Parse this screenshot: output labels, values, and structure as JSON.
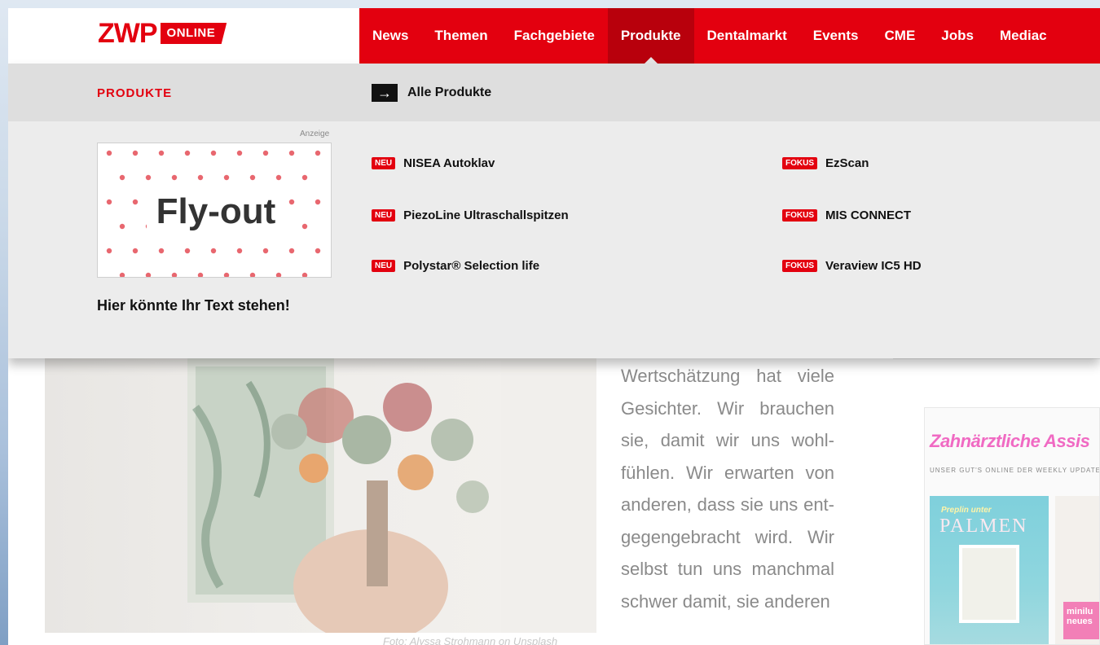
{
  "brand": {
    "logo_main": "ZWP",
    "logo_badge": "ONLINE",
    "accent": "#e3000f"
  },
  "nav": {
    "items": [
      {
        "label": "News"
      },
      {
        "label": "Themen"
      },
      {
        "label": "Fachgebiete"
      },
      {
        "label": "Produkte",
        "active": true
      },
      {
        "label": "Dentalmarkt"
      },
      {
        "label": "Events"
      },
      {
        "label": "CME"
      },
      {
        "label": "Jobs"
      },
      {
        "label": "Mediac"
      }
    ]
  },
  "flyout": {
    "title": "PRODUKTE",
    "all_link": "Alle Produkte",
    "ad": {
      "label": "Anzeige",
      "image_text": "Fly-out",
      "caption": "Hier könnte Ihr Text stehen!"
    },
    "products_left": [
      {
        "badge": "NEU",
        "label": "NISEA Autoklav"
      },
      {
        "badge": "NEU",
        "label": "PiezoLine Ultraschallspitzen"
      },
      {
        "badge": "NEU",
        "label": "Polystar® Selection life"
      }
    ],
    "products_right": [
      {
        "badge": "FOKUS",
        "label": "EzScan"
      },
      {
        "badge": "FOKUS",
        "label": "MIS CONNECT"
      },
      {
        "badge": "FOKUS",
        "label": "Veraview IC5 HD"
      }
    ]
  },
  "article": {
    "photo_caption": "Foto: Alyssa Strohmann on Unsplash",
    "text": "Wertschätzung hat viele Gesichter. Wir brauchen sie, damit wir uns wohl-fühlen. Wir erwarten von anderen, dass sie uns ent-gegengebracht wird. Wir selbst tun uns manchmal schwer damit, sie anderen"
  },
  "magazine": {
    "title": "Zahnärztliche Assis",
    "subtitle": "UNSER GUT'S ONLINE   DER WEEKLY UPDATE   UNSERE COMMU",
    "cover_kicker": "Preplin unter",
    "cover_title": "PALMEN",
    "badge_text": "minilu neues"
  }
}
